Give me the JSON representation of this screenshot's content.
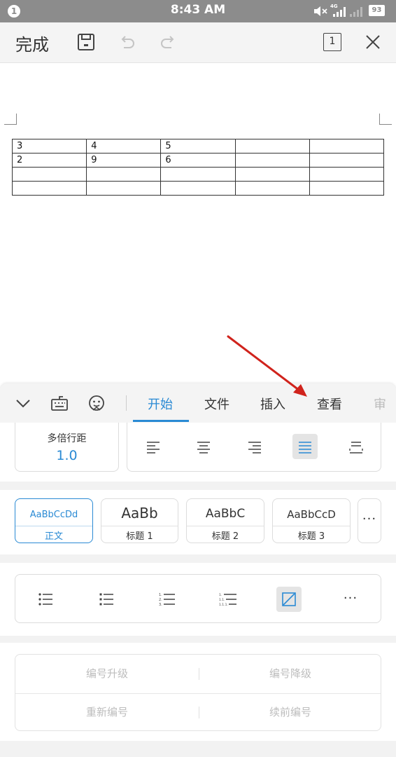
{
  "status_bar": {
    "notification_count": "1",
    "time": "8:43 AM",
    "network": "4G",
    "battery": "93",
    "icons": [
      "mute-icon",
      "signal-icon",
      "signal-weak-icon",
      "battery-icon"
    ]
  },
  "toolbar": {
    "done_label": "完成",
    "page_number": "1",
    "icons": [
      "save-icon",
      "undo-icon",
      "redo-icon",
      "page-count-icon",
      "close-icon"
    ]
  },
  "document": {
    "table": [
      [
        "3",
        "4",
        "5",
        "",
        ""
      ],
      [
        "2",
        "9",
        "6",
        "",
        ""
      ],
      [
        "",
        "",
        "",
        "",
        ""
      ],
      [
        "",
        "",
        "",
        "",
        ""
      ]
    ]
  },
  "panel": {
    "tabs": [
      {
        "label": "开始",
        "active": true
      },
      {
        "label": "文件",
        "active": false
      },
      {
        "label": "插入",
        "active": false
      },
      {
        "label": "查看",
        "active": false
      },
      {
        "label": "审",
        "active": false
      }
    ],
    "icons": [
      "collapse-chevron-icon",
      "keyboard-icon",
      "assistant-icon"
    ],
    "line_spacing": {
      "label": "多倍行距",
      "value": "1.0"
    },
    "alignment": {
      "options": [
        "align-left-icon",
        "align-center-icon",
        "align-right-icon",
        "align-justify-icon",
        "align-distributed-icon"
      ],
      "selected": "align-justify-icon"
    },
    "styles": [
      {
        "sample": "AaBbCcDd",
        "name": "正文",
        "active": true
      },
      {
        "sample": "AaBb",
        "name": "标题 1",
        "active": false
      },
      {
        "sample": "AaBbC",
        "name": "标题 2",
        "active": false
      },
      {
        "sample": "AaBbCcD",
        "name": "标题 3",
        "active": false
      }
    ],
    "more_label": "···",
    "lists": {
      "options": [
        "bullet-list-icon",
        "hollow-bullet-list-icon",
        "numbered-list-icon",
        "multilevel-list-icon",
        "no-list-icon"
      ],
      "selected": "no-list-icon",
      "more_label": "···"
    },
    "numbering": {
      "promote": "编号升级",
      "demote": "编号降级",
      "restart": "重新编号",
      "continue": "续前编号"
    }
  },
  "colors": {
    "accent": "#2a8ad4",
    "annotation_arrow": "#d0231c",
    "status_bar": "#8c8c8c"
  }
}
